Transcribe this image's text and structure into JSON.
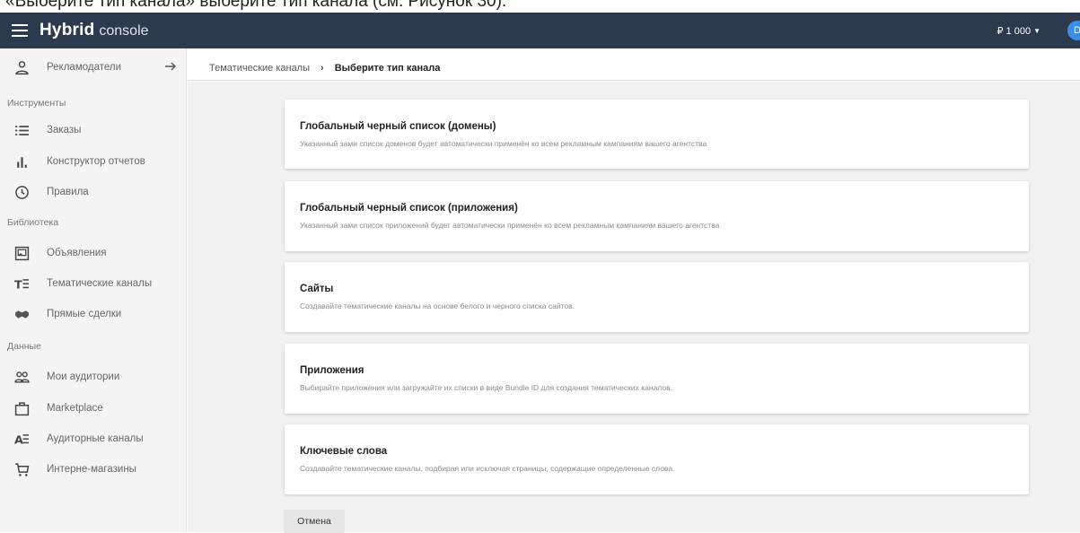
{
  "caption": "«Выберите тип канала» выберите тип канала (см. Рисунок 30).",
  "header": {
    "brand_main": "Hybrid",
    "brand_sub": "console",
    "balance": "₽ 1 000",
    "avatar_initial": "D"
  },
  "sidebar": {
    "advertisers": "Рекламодатели",
    "section_tools": "Инструменты",
    "orders": "Заказы",
    "report_builder": "Конструктор отчетов",
    "rules": "Правила",
    "section_library": "Библиотека",
    "ads": "Объявления",
    "thematic_channels": "Тематические каналы",
    "direct_deals": "Прямые сделки",
    "section_data": "Данные",
    "my_audiences": "Мои аудитории",
    "marketplace": "Marketplace",
    "audience_channels": "Аудиторные каналы",
    "online_stores": "Интерне-магазины"
  },
  "breadcrumb": {
    "parent": "Тематические каналы",
    "separator": "›",
    "current": "Выберите тип канала"
  },
  "cards": [
    {
      "title": "Глобальный черный список (домены)",
      "desc": "Указанный зами список доменов будет автоматически применён ко всем рекламным кампаниям вашего агентства"
    },
    {
      "title": "Глобальный черный список (приложения)",
      "desc": "Указанный зами список приложений будет автоматически применён ко всем рекламным кампаниям вашего агентства"
    },
    {
      "title": "Сайты",
      "desc": "Создавайте тематические каналы на основе белого и черного списка сайтов."
    },
    {
      "title": "Приложения",
      "desc": "Выбирайте приложения или загружайте их списки в виде Bundle ID для создания тематических каналов."
    },
    {
      "title": "Ключевые слова",
      "desc": "Создавайте тематические каналы, подбирая или исключая страницы, содержащие определенные слова."
    }
  ],
  "cancel_label": "Отмена",
  "colors": {
    "topbar": "#2b3a4e",
    "avatar": "#3b8ee8",
    "sidebar_bg": "#f4f4f4",
    "content_bg": "#f1f1f1"
  }
}
